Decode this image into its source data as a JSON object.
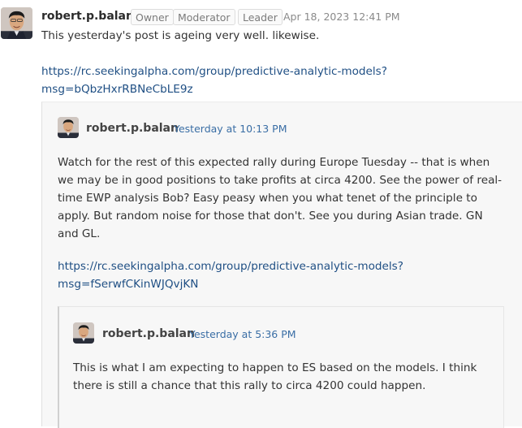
{
  "post": {
    "author": "robert.p.balan",
    "badges": [
      "Owner",
      "Moderator",
      "Leader"
    ],
    "timestamp": "Apr 18, 2023 12:41 PM",
    "body": "This yesterday's post is ageing very well. likewise.",
    "link_line1": "https://rc.seekingalpha.com/group/predictive-analytic-models?",
    "link_line2": "msg=bQbzHxrRBNeCbLE9z"
  },
  "quote1": {
    "author": "robert.p.balan",
    "timestamp": "Yesterday at 10:13 PM",
    "body_lines": [
      "Watch for the rest of this expected rally during Europe Tuesday -- that is when",
      "we may be in good positions to take profits at circa 4200. See the power of real-",
      "time EWP analysis Bob? Easy peasy when you what tenet of the principle to",
      "apply. But random noise for those that don't. See you during Asian trade. GN",
      "and GL."
    ],
    "link_line1": "https://rc.seekingalpha.com/group/predictive-analytic-models?",
    "link_line2": "msg=fSerwfCKinWJQvjKN"
  },
  "quote2": {
    "author": "robert.p.balan",
    "timestamp": "Yesterday at 5:36 PM",
    "body_lines": [
      "This is what I am expecting to happen to ES based on the models. I think",
      "there is still a chance that this rally to circa 4200 could happen."
    ]
  },
  "colors": {
    "link": "#1f4f84",
    "quote_bg": "#f7f7f7"
  },
  "icons": {
    "avatar": "user-avatar-photo"
  }
}
